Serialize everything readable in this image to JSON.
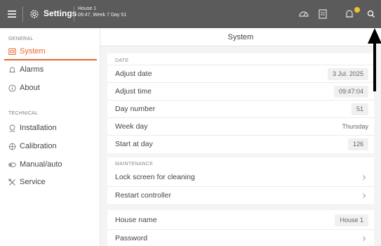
{
  "header": {
    "title": "Settings",
    "house_name": "House 1",
    "house_sub": "09:47, Week 7 Day 51",
    "notification_color": "#f5c12a",
    "icons": [
      "menu-icon",
      "gear-icon",
      "gauge-icon",
      "document-icon",
      "bell-icon",
      "search-icon"
    ]
  },
  "sidebar": {
    "general_label": "GENERAL",
    "technical_label": "TECHNICAL",
    "items": [
      {
        "label": "System",
        "icon": "system-icon",
        "active": true
      },
      {
        "label": "Alarms",
        "icon": "bell-icon"
      },
      {
        "label": "About",
        "icon": "info-icon"
      },
      {
        "label": "Installation",
        "icon": "installation-icon"
      },
      {
        "label": "Calibration",
        "icon": "calibration-icon"
      },
      {
        "label": "Manual/auto",
        "icon": "toggle-icon"
      },
      {
        "label": "Service",
        "icon": "tools-icon"
      }
    ],
    "accent_color": "#e8672c"
  },
  "main": {
    "title": "System",
    "date_section": {
      "label": "DATE",
      "rows": [
        {
          "label": "Adjust date",
          "value": "3 Jul. 2025"
        },
        {
          "label": "Adjust time",
          "value": "09:47:04"
        },
        {
          "label": "Day number",
          "value": "51"
        },
        {
          "label": "Week day",
          "value": "Thursday"
        },
        {
          "label": "Start at day",
          "value": "126"
        }
      ]
    },
    "maintenance_section": {
      "label": "MAINTENANCE",
      "rows": [
        {
          "label": "Lock screen for cleaning"
        },
        {
          "label": "Restart controller"
        }
      ]
    },
    "other_section": {
      "rows": [
        {
          "label": "House name",
          "value": "House 1"
        },
        {
          "label": "Password"
        }
      ]
    }
  }
}
